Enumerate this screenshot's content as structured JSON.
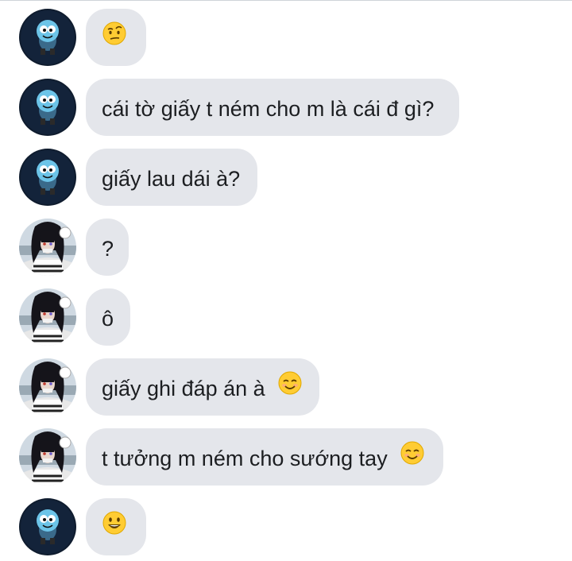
{
  "messages": [
    {
      "sender": "gumball",
      "text": "",
      "emoji": "raised-eyebrow-face"
    },
    {
      "sender": "gumball",
      "text": "cái tờ giấy t ném cho m là cái đ gì?",
      "emoji": ""
    },
    {
      "sender": "gumball",
      "text": "giấy lau dái à?",
      "emoji": ""
    },
    {
      "sender": "obanai",
      "text": "?",
      "emoji": ""
    },
    {
      "sender": "obanai",
      "text": "ô",
      "emoji": ""
    },
    {
      "sender": "obanai",
      "text": "giấy ghi đáp án à",
      "emoji": "smiling-face"
    },
    {
      "sender": "obanai",
      "text": "t tưởng m ném cho sướng tay",
      "emoji": "smiling-face"
    },
    {
      "sender": "gumball",
      "text": "",
      "emoji": "grinning-face"
    }
  ],
  "colors": {
    "bubble_bg": "#e4e6eb",
    "text": "#1c1e21",
    "emoji_yellow": "#ffcc33"
  }
}
